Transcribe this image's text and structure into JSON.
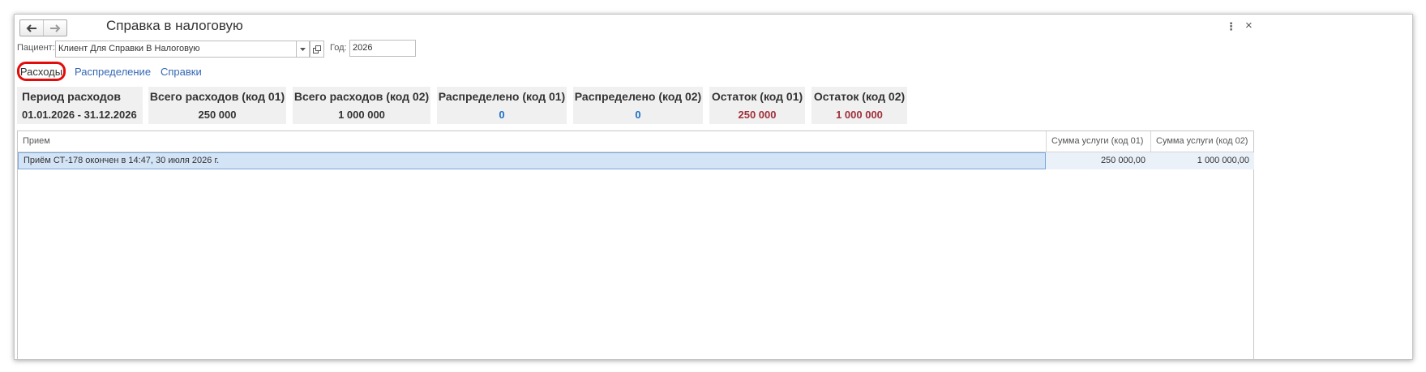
{
  "window": {
    "title": "Справка в налоговую",
    "back_icon": "arrow-left-icon",
    "forward_icon": "arrow-right-icon",
    "more_glyph": "⋮",
    "close_glyph": "×"
  },
  "form": {
    "patient_label": "Пациент:",
    "patient_value": "Клиент Для Справки В Налоговую",
    "year_label": "Год:",
    "year_value": "2026"
  },
  "tabs": [
    {
      "label": "Расходы",
      "active": true
    },
    {
      "label": "Распределение",
      "active": false
    },
    {
      "label": "Справки",
      "active": false
    }
  ],
  "summary": [
    {
      "header": "Период расходов",
      "value": "01.01.2026 - 31.12.2026",
      "color": "#333333"
    },
    {
      "header": "Всего расходов (код 01)",
      "value": "250 000",
      "color": "#333333"
    },
    {
      "header": "Всего расходов (код 02)",
      "value": "1 000 000",
      "color": "#333333"
    },
    {
      "header": "Распределено (код 01)",
      "value": "0",
      "color": "#1f6fc5"
    },
    {
      "header": "Распределено (код 02)",
      "value": "0",
      "color": "#1f6fc5"
    },
    {
      "header": "Остаток (код 01)",
      "value": "250 000",
      "color": "#a0303a"
    },
    {
      "header": "Остаток (код 02)",
      "value": "1 000 000",
      "color": "#a0303a"
    }
  ],
  "table": {
    "columns": [
      "Прием",
      "Сумма услуги (код 01)",
      "Сумма услуги (код 02)"
    ],
    "rows": [
      [
        "Приём СТ-178 окончен в 14:47, 30 июля 2026 г.",
        "250 000,00",
        "1 000 000,00"
      ]
    ]
  },
  "colors": {
    "link": "#3568b5",
    "active_tab_outline": "#e30c0c",
    "selected_row": "#d3e4f6"
  }
}
